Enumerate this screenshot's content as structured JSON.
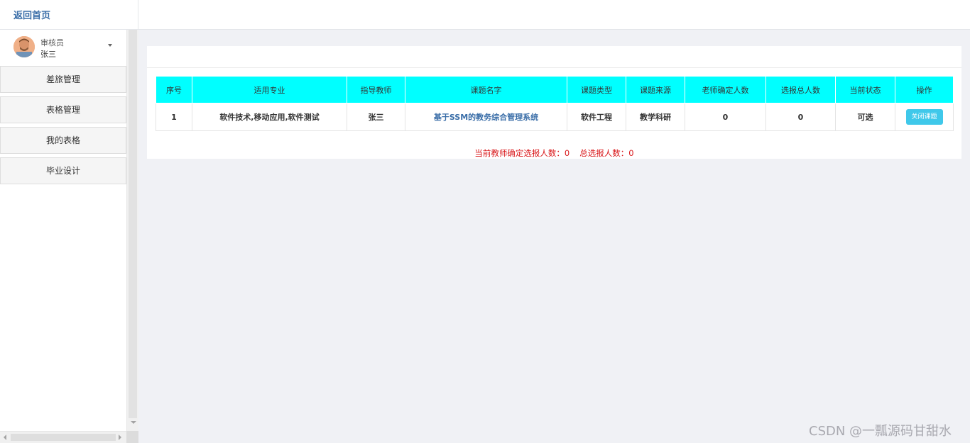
{
  "header": {
    "home_link": "返回首页"
  },
  "user": {
    "role": "审核员",
    "name": "张三"
  },
  "sidebar": {
    "items": [
      {
        "label": "差旅管理"
      },
      {
        "label": "表格管理"
      },
      {
        "label": "我的表格"
      },
      {
        "label": "毕业设计"
      }
    ]
  },
  "table": {
    "headers": [
      "序号",
      "适用专业",
      "指导教师",
      "课题名字",
      "课题类型",
      "课题来源",
      "老师确定人数",
      "选报总人数",
      "当前状态",
      "操作"
    ],
    "rows": [
      {
        "index": "1",
        "major": "软件技术,移动应用,软件测试",
        "teacher": "张三",
        "topic": "基于SSM的教务综合管理系统",
        "type": "软件工程",
        "source": "教学科研",
        "confirmed": "0",
        "total": "0",
        "status": "可选",
        "action": "关闭课题"
      }
    ]
  },
  "summary": {
    "confirmed_text": "当前教师确定选报人数：0",
    "total_text": "总选报人数：0"
  },
  "watermark": "CSDN @一瓢源码甘甜水",
  "colors": {
    "table_header_bg": "#00ffff",
    "accent": "#3a6ea8",
    "summary_text": "#d9181b",
    "button_bg": "#3fc8ea"
  }
}
